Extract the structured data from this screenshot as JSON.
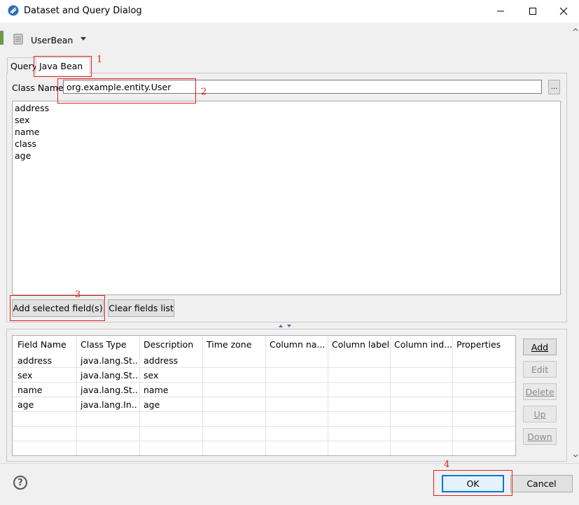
{
  "window": {
    "title": "Dataset and Query Dialog"
  },
  "toolbar": {
    "dataset_name": "UserBean"
  },
  "tabs": [
    {
      "label": "Query"
    },
    {
      "label": "Java Bean"
    }
  ],
  "javabean": {
    "class_label": "Class Name",
    "class_value": "org.example.entity.User",
    "browse_label": "...",
    "fields": [
      "address",
      "sex",
      "name",
      "class",
      "age"
    ],
    "add_selected_label": "Add selected field(s)",
    "clear_fields_label": "Clear fields list"
  },
  "grid": {
    "columns": [
      "Field Name",
      "Class Type",
      "Description",
      "Time zone",
      "Column na...",
      "Column label",
      "Column ind...",
      "Properties"
    ],
    "rows": [
      [
        "address",
        "java.lang.St...",
        "address"
      ],
      [
        "sex",
        "java.lang.St...",
        "sex"
      ],
      [
        "name",
        "java.lang.St...",
        "name"
      ],
      [
        "age",
        "java.lang.In...",
        "age"
      ]
    ]
  },
  "side_buttons": {
    "add": "Add",
    "edit": "Edit",
    "delete": "Delete",
    "up": "Up",
    "down": "Down"
  },
  "footer": {
    "ok": "OK",
    "cancel": "Cancel",
    "help_glyph": "?"
  },
  "annotations": [
    "1",
    "2",
    "3",
    "4"
  ],
  "colors": {
    "annotation": "#e02020",
    "ok_border": "#0078d7"
  }
}
